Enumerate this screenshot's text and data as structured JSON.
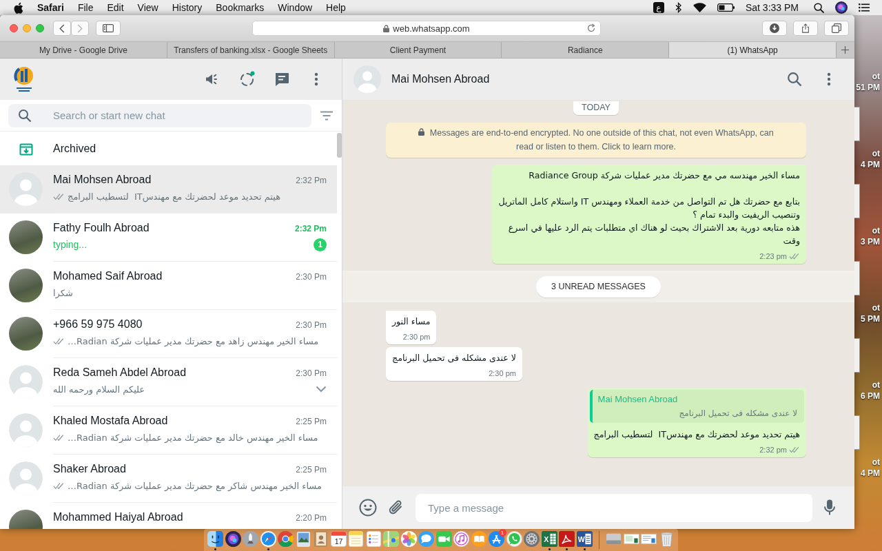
{
  "menu_bar": {
    "app_name": "Safari",
    "menus": [
      "File",
      "Edit",
      "View",
      "History",
      "Bookmarks",
      "Window",
      "Help"
    ],
    "input_source": "ع",
    "clock": "Sat 3:33 PM"
  },
  "browser": {
    "address": "web.whatsapp.com",
    "tabs": [
      {
        "label": "My Drive - Google Drive",
        "selected": false
      },
      {
        "label": "Transfers of banking.xlsx - Google Sheets",
        "selected": false
      },
      {
        "label": "Client Payment",
        "selected": false
      },
      {
        "label": "Radiance",
        "selected": false
      },
      {
        "label": "(1) WhatsApp",
        "selected": true
      }
    ]
  },
  "sidebar": {
    "search": {
      "placeholder": "Search or start new chat"
    },
    "archived_label": "Archived",
    "chats": [
      {
        "name": "Mai Mohsen Abroad",
        "time": "2:32 Pm",
        "preview": "هيتم تحديد موعد لحضرتك مع مهندسIT  لتسطيب البرامج",
        "avatar": {
          "kind": "default"
        },
        "ticks": true,
        "typing": false,
        "chevron": false,
        "selected": true
      },
      {
        "name": "Fathy Foulh Abroad",
        "time": "2:32 Pm",
        "preview": "typing...",
        "avatar": {
          "kind": "photo"
        },
        "ticks": false,
        "typing": true,
        "unread_count": "1",
        "chevron": false,
        "selected": false
      },
      {
        "name": "Mohamed Saif Abroad",
        "time": "2:30 Pm",
        "preview": "شكرا",
        "avatar": {
          "kind": "photo"
        },
        "ticks": false,
        "typing": false,
        "chevron": false,
        "selected": false
      },
      {
        "name": "+966 59 975 4080",
        "time": "2:30 Pm",
        "preview": "مساء الخير مهندس زاهد مع حضرتك مدير عمليات شركة Radian…",
        "avatar": {
          "kind": "photo"
        },
        "ticks": true,
        "typing": false,
        "chevron": false,
        "selected": false
      },
      {
        "name": "Reda Sameh Abdel Abroad",
        "time": "2:30 Pm",
        "preview": "عليكم السلام ورحمه الله",
        "avatar": {
          "kind": "default"
        },
        "ticks": false,
        "typing": false,
        "chevron": true,
        "selected": false
      },
      {
        "name": "Khaled Mostafa Abroad",
        "time": "2:25 Pm",
        "preview": "مساء الخير مهندس خالد مع حضرتك مدير عمليات شركة Radian…",
        "avatar": {
          "kind": "default"
        },
        "ticks": true,
        "typing": false,
        "chevron": false,
        "selected": false
      },
      {
        "name": "Shaker Abroad",
        "time": "2:25 Pm",
        "preview": "مساء الخير مهندس شاكر مع حضرتك مدير عمليات شركة Radian…",
        "avatar": {
          "kind": "default"
        },
        "ticks": true,
        "typing": false,
        "chevron": false,
        "selected": false
      },
      {
        "name": "Mohammed Haiyal Abroad",
        "time": "2:20 Pm",
        "avatar": {
          "kind": "photo"
        },
        "ticks": false,
        "chevron": false,
        "selected": false
      }
    ]
  },
  "conversation": {
    "contact": "Mai Mohsen Abroad",
    "date_chip": "TODAY",
    "encryption_notice": "Messages are end-to-end encrypted. No one outside of this chat, not even WhatsApp, can read or listen to them. Click to learn more.",
    "messages": [
      {
        "kind": "outgoing",
        "text": "مساء الخير مهندسه مي مع حضرتك مدير عمليات شركة Radiance Group\n\nبتابع مع حضرتك هل تم التواصل من خدمة العملاء ومهندس IT واستلام كامل الماتريل وتنصيب الريفيت والبدء تمام ؟\nهذه متابعه دورية بعد الاشتراك بحيث لو هناك اي متطلبات يتم الرد عليها في اسرع وقت",
        "time": "2:23 pm",
        "ticks": true,
        "tail": true
      },
      {
        "kind": "unread_divider",
        "text": "3 UNREAD MESSAGES"
      },
      {
        "kind": "incoming",
        "text": "مساء النور",
        "time": "2:30 pm",
        "tail": true
      },
      {
        "kind": "incoming",
        "text": "لا عندى مشكله فى تحميل البرنامج",
        "time": "2:30 pm",
        "tail": false
      },
      {
        "kind": "outgoing",
        "quote": {
          "author": "Mai Mohsen Abroad",
          "text": "لا عندى مشكله فى تحميل البرنامج"
        },
        "text": "هيتم تحديد موعد لحضرتك مع مهندسIT  لتسطيب البرامج",
        "time": "2:32 pm",
        "ticks": true,
        "tail": true
      }
    ],
    "composer": {
      "placeholder": "Type a message"
    }
  },
  "desktop_files": [
    {
      "lines": [
        "ot",
        "51 PM"
      ],
      "thumbnail_visible": false
    },
    {
      "lines": [
        "ot",
        "4 PM"
      ],
      "thumbnail_visible": true
    },
    {
      "lines": [
        "ot",
        "3 PM"
      ],
      "thumbnail_visible": true
    },
    {
      "lines": [
        "ot",
        "5 PM"
      ],
      "thumbnail_visible": true
    },
    {
      "lines": [
        "ot",
        "6 PM"
      ],
      "thumbnail_visible": true
    },
    {
      "lines": [
        "ot",
        "4 PM"
      ],
      "thumbnail_visible": true
    }
  ],
  "dock": {
    "items": [
      {
        "kind": "finder",
        "running": true
      },
      {
        "kind": "siri",
        "running": false
      },
      {
        "kind": "launchpad",
        "running": false
      },
      {
        "kind": "safari",
        "running": true
      },
      {
        "kind": "chrome",
        "running": false
      },
      {
        "kind": "preview",
        "running": false
      },
      {
        "kind": "contacts",
        "running": false
      },
      {
        "kind": "calendar",
        "label": "17",
        "running": false
      },
      {
        "kind": "notes",
        "running": false
      },
      {
        "kind": "reminders",
        "running": false
      },
      {
        "kind": "maps",
        "running": false
      },
      {
        "kind": "photos",
        "running": false
      },
      {
        "kind": "messages",
        "running": false
      },
      {
        "kind": "facetime",
        "running": false
      },
      {
        "kind": "itunes",
        "running": false
      },
      {
        "kind": "ibooks",
        "running": false
      },
      {
        "kind": "appstore",
        "badge": "1",
        "running": false
      },
      {
        "kind": "whatsapp",
        "running": false
      },
      {
        "kind": "sysprefs",
        "running": false
      },
      {
        "kind": "excel",
        "glyph": "X",
        "running": true
      },
      {
        "kind": "acrobat",
        "running": true
      },
      {
        "kind": "word",
        "glyph": "W",
        "running": true
      },
      {
        "kind": "separator"
      },
      {
        "kind": "drive",
        "running": false
      },
      {
        "kind": "sheetdoc",
        "running": false
      },
      {
        "kind": "doc",
        "running": false
      },
      {
        "kind": "trash",
        "running": false
      }
    ]
  }
}
